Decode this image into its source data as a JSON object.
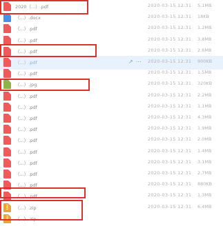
{
  "files": [
    {
      "name": "2020（...）.pdf",
      "date": "2020-03-15 12:31",
      "size": "5.1MB",
      "type": "pdf"
    },
    {
      "name": "（...）.docx",
      "date": "2020-03-15 12:31",
      "size": "18KB",
      "type": "doc"
    },
    {
      "name": "（...）.pdf",
      "date": "2020-03-15 12:31",
      "size": "1.2MB",
      "type": "pdf"
    },
    {
      "name": "（...）.pdf",
      "date": "2020-03-15 12:31",
      "size": "3.8MB",
      "type": "pdf"
    },
    {
      "name": "（...）.pdf",
      "date": "2020-03-15 12:31",
      "size": "2.6MB",
      "type": "pdf"
    },
    {
      "name": "（...）.pdf",
      "date": "2020-03-15 12:31",
      "size": "900KB",
      "type": "pdf",
      "selected": true
    },
    {
      "name": "（...）.pdf",
      "date": "2020-03-15 12:31",
      "size": "1.5MB",
      "type": "pdf"
    },
    {
      "name": "（...）.jpg",
      "date": "2020-03-15 12:31",
      "size": "320KB",
      "type": "img"
    },
    {
      "name": "（...）.pdf",
      "date": "2020-03-15 12:31",
      "size": "2.2MB",
      "type": "pdf"
    },
    {
      "name": "（...）.pdf",
      "date": "2020-03-15 12:31",
      "size": "1.1MB",
      "type": "pdf"
    },
    {
      "name": "（...）.pdf",
      "date": "2020-03-15 12:31",
      "size": "4.3MB",
      "type": "pdf"
    },
    {
      "name": "（...）.pdf",
      "date": "2020-03-15 12:31",
      "size": "1.9MB",
      "type": "pdf"
    },
    {
      "name": "（...）.pdf",
      "date": "2020-03-15 12:31",
      "size": "2.0MB",
      "type": "pdf"
    },
    {
      "name": "（...）.pdf",
      "date": "2020-03-15 12:31",
      "size": "1.4MB",
      "type": "pdf"
    },
    {
      "name": "（...）.pdf",
      "date": "2020-03-15 12:31",
      "size": "3.1MB",
      "type": "pdf"
    },
    {
      "name": "（...）.pdf",
      "date": "2020-03-15 12:31",
      "size": "2.7MB",
      "type": "pdf"
    },
    {
      "name": "（...）.pdf",
      "date": "2020-03-15 12:31",
      "size": "880KB",
      "type": "pdf"
    },
    {
      "name": "（...）.pdf",
      "date": "2020-03-15 12:31",
      "size": "1.3MB",
      "type": "pdf"
    },
    {
      "name": "（...）.zip",
      "date": "2020-03-15 12:31",
      "size": "6.4MB",
      "type": "zip"
    },
    {
      "name": "（...）.zip",
      "date": "",
      "size": "",
      "type": "zip"
    }
  ],
  "row_actions": [
    "↗",
    "⋯"
  ],
  "colors": {
    "highlight": "#e8f2fc",
    "annotation": "#d9312b"
  }
}
